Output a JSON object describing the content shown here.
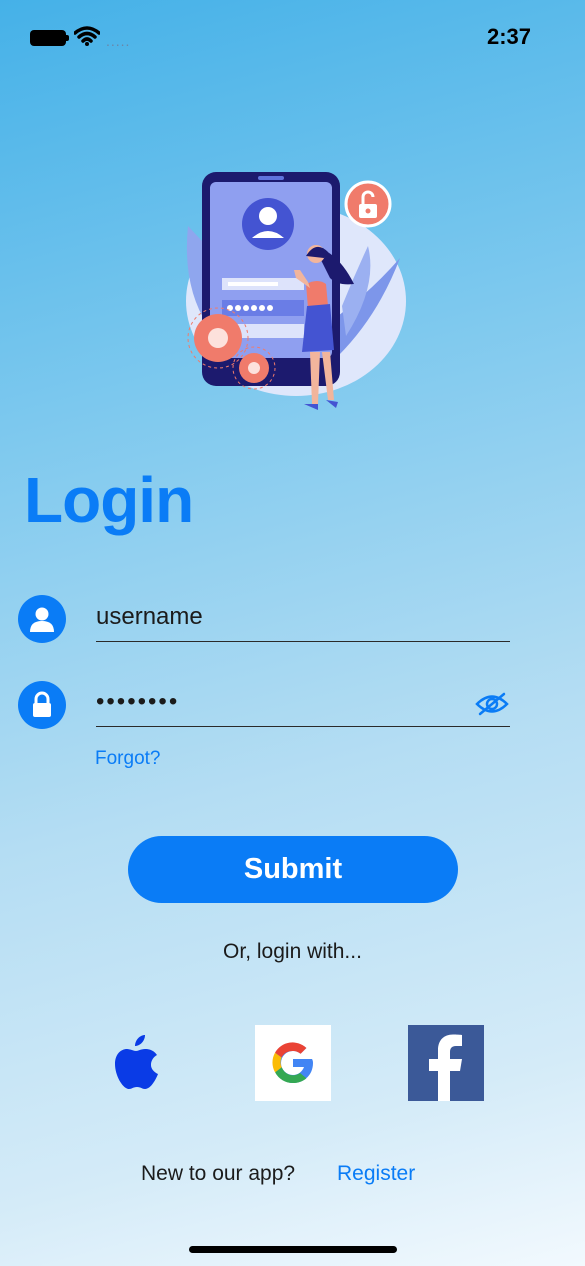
{
  "status": {
    "time": "2:37",
    "signal": "....."
  },
  "title": "Login",
  "fields": {
    "username": {
      "value": "username"
    },
    "password": {
      "value": "••••••••"
    }
  },
  "forgot_label": "Forgot?",
  "submit_label": "Submit",
  "social": {
    "heading": "Or, login with...",
    "providers": [
      "apple-icon",
      "google-icon",
      "facebook-icon"
    ]
  },
  "footer": {
    "prompt": "New to our app?",
    "register_label": "Register"
  },
  "colors": {
    "accent": "#0a7cf6",
    "facebook": "#3b5998",
    "illustration_accent": "#f07b6b"
  }
}
